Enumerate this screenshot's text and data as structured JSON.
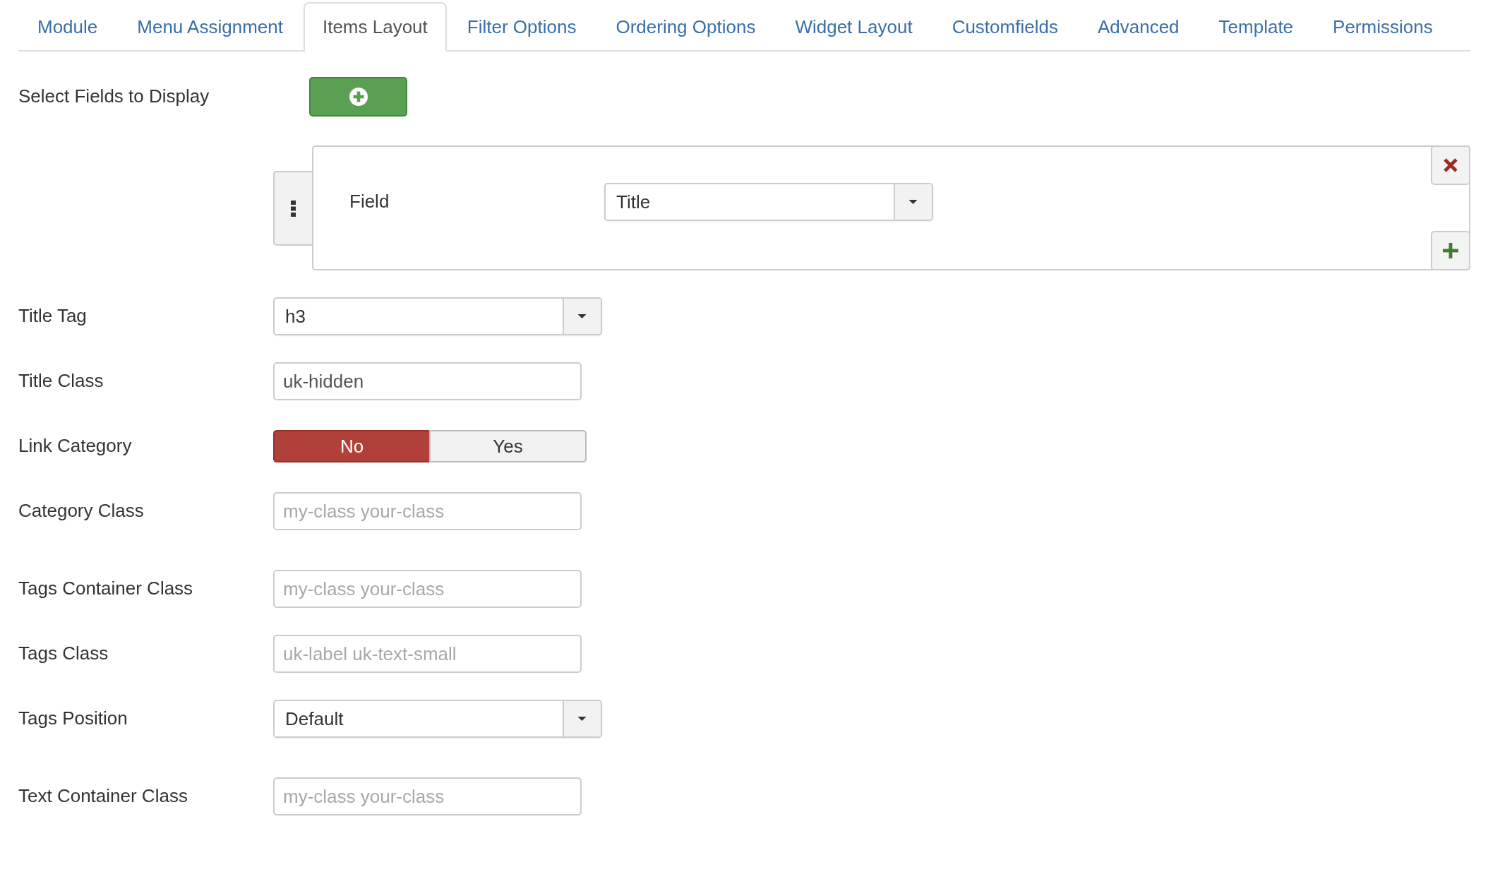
{
  "tabs": [
    {
      "label": "Module",
      "selected": false
    },
    {
      "label": "Menu Assignment",
      "selected": false
    },
    {
      "label": "Items Layout",
      "selected": true
    },
    {
      "label": "Filter Options",
      "selected": false
    },
    {
      "label": "Ordering Options",
      "selected": false
    },
    {
      "label": "Widget Layout",
      "selected": false
    },
    {
      "label": "Customfields",
      "selected": false
    },
    {
      "label": "Advanced",
      "selected": false
    },
    {
      "label": "Template",
      "selected": false
    },
    {
      "label": "Permissions",
      "selected": false
    }
  ],
  "select_fields": {
    "label": "Select Fields to Display",
    "items": [
      {
        "label": "Field",
        "value": "Title"
      }
    ]
  },
  "field_groups": [
    {
      "fields": [
        {
          "kind": "select",
          "label": "Title Tag",
          "value": "h3"
        },
        {
          "kind": "text",
          "label": "Title Class",
          "value": "uk-hidden"
        },
        {
          "kind": "toggle",
          "label": "Link Category",
          "options": [
            {
              "label": "No",
              "selected": true
            },
            {
              "label": "Yes",
              "selected": false
            }
          ]
        },
        {
          "kind": "text",
          "label": "Category Class",
          "placeholder": "my-class your-class"
        }
      ]
    },
    {
      "fields": [
        {
          "kind": "text",
          "label": "Tags Container Class",
          "placeholder": "my-class your-class"
        },
        {
          "kind": "text",
          "label": "Tags Class",
          "placeholder": "uk-label uk-text-small"
        },
        {
          "kind": "select",
          "label": "Tags Position",
          "value": "Default"
        }
      ]
    },
    {
      "fields": [
        {
          "kind": "text",
          "label": "Text Container Class",
          "placeholder": "my-class your-class"
        }
      ]
    }
  ]
}
